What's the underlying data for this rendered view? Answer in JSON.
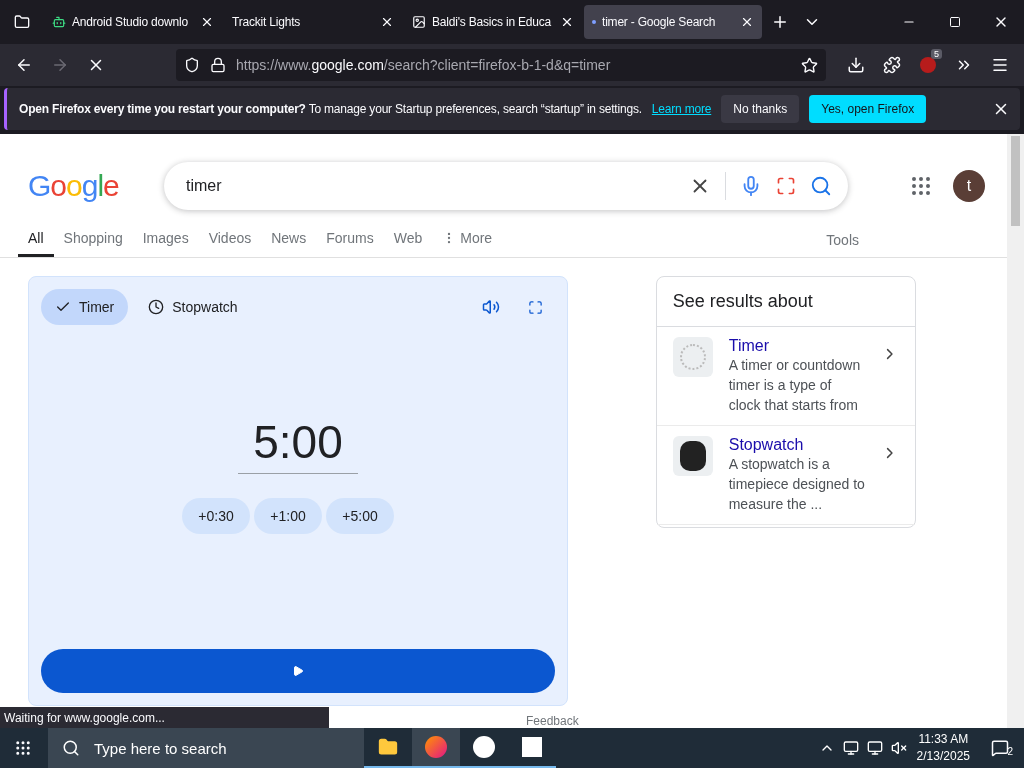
{
  "browser_tabs": [
    {
      "title": "Android Studio downlo",
      "kind": "android",
      "selected": false
    },
    {
      "title": "Trackit Lights",
      "kind": "none",
      "selected": false
    },
    {
      "title": "Baldi's Basics in Educa",
      "kind": "image",
      "selected": false
    },
    {
      "title": "timer - Google Search",
      "kind": "loading",
      "selected": true
    }
  ],
  "address_bar": {
    "prefix": "https://www.",
    "domain": "google.com",
    "suffix": "/search?client=firefox-b-1-d&q=timer"
  },
  "extension_badge": "5",
  "notification": {
    "message": "**Open Firefox every time you restart your computer?** To manage your Startup preferences, search “startup” in settings.",
    "link": "Learn more",
    "buttons": [
      {
        "label": "No thanks",
        "kind": "secondary"
      },
      {
        "label": "Yes, open Firefox",
        "kind": "primary"
      }
    ]
  },
  "google": {
    "logo": "Google",
    "query": "timer",
    "avatar": "t"
  },
  "search_tabs": [
    {
      "label": "All",
      "kind": "plain",
      "selected": true
    },
    {
      "label": "Shopping",
      "kind": "plain",
      "selected": false
    },
    {
      "label": "Images",
      "kind": "plain",
      "selected": false
    },
    {
      "label": "Videos",
      "kind": "plain",
      "selected": false
    },
    {
      "label": "News",
      "kind": "plain",
      "selected": false
    },
    {
      "label": "Forums",
      "kind": "plain",
      "selected": false
    },
    {
      "label": "Web",
      "kind": "plain",
      "selected": false
    },
    {
      "label": "More",
      "kind": "menu",
      "selected": false
    }
  ],
  "tools": "Tools",
  "timer_widget": {
    "modes": [
      {
        "label": "Timer",
        "kind": "timer",
        "selected": true
      },
      {
        "label": "Stopwatch",
        "kind": "stopwatch",
        "selected": false
      }
    ],
    "time": "5:00",
    "increments": [
      "+0:30",
      "+1:00",
      "+5:00"
    ]
  },
  "knowledge_panel": {
    "title": "See results about",
    "items": [
      {
        "title": "Timer",
        "kind": "timer",
        "description": "A timer or countdown timer is a type of clock that starts from"
      },
      {
        "title": "Stopwatch",
        "kind": "stopwatch",
        "description": "A stopwatch is a timepiece designed to measure the ..."
      }
    ]
  },
  "feedback": "Feedback",
  "status": "Waiting for www.google.com...",
  "taskbar": {
    "search_placeholder": "Type here to search",
    "time": "11:33 AM",
    "date": "2/13/2025",
    "notifications": "2"
  }
}
